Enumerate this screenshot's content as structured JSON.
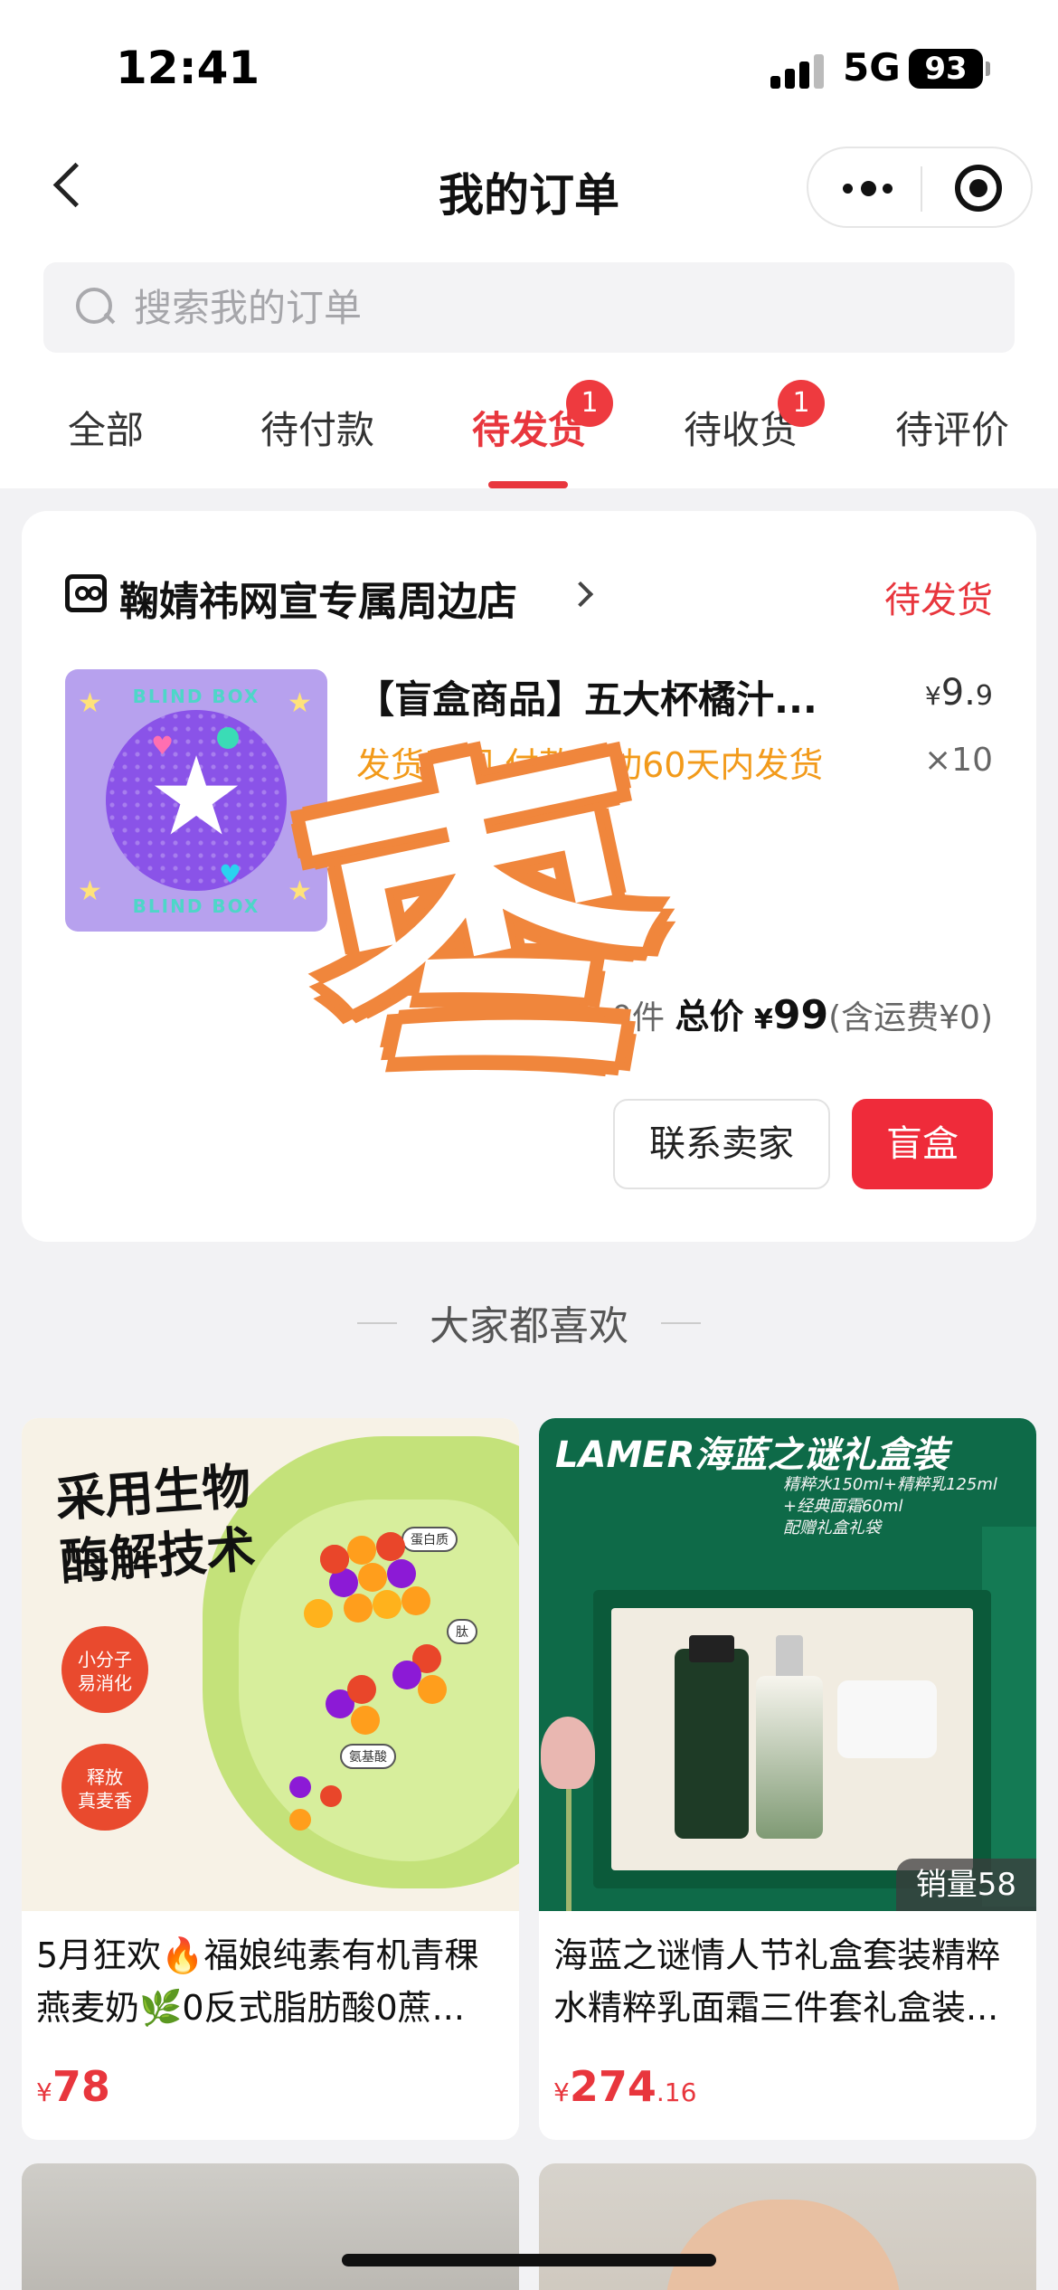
{
  "status_bar": {
    "time": "12:41",
    "network": "5G",
    "battery": "93"
  },
  "nav": {
    "title": "我的订单"
  },
  "search": {
    "placeholder": "搜索我的订单"
  },
  "tabs": [
    {
      "label": "全部",
      "badge": ""
    },
    {
      "label": "待付款",
      "badge": ""
    },
    {
      "label": "待发货",
      "badge": "1",
      "active": true
    },
    {
      "label": "待收货",
      "badge": "1"
    },
    {
      "label": "待评价",
      "badge": ""
    }
  ],
  "order": {
    "store_name": "鞠婧祎网宣专属周边店",
    "status": "待发货",
    "product": {
      "title": "【盲盒商品】五大杯橘汁...",
      "thumb_text_top": "BLIND BOX",
      "thumb_text_bottom": "BLIND BOX",
      "price_currency": "¥",
      "price_int": "9.",
      "price_dec": "9",
      "shipping_note": "发货时间 付款成功60天内发货",
      "quantity": "×10"
    },
    "total": {
      "count_text": "0件",
      "label": "总价",
      "currency": "¥",
      "amount": "99",
      "shipping": "(含运费¥0)"
    },
    "buttons": {
      "contact": "联系卖家",
      "primary": "盲盒"
    },
    "stamp": "枣"
  },
  "recommend": {
    "title": "大家都喜欢",
    "items": [
      {
        "name": "5月狂欢🔥福娘纯素有机青稞燕麦奶🌿0反式脂肪酸0蔗...",
        "price_currency": "¥",
        "price_int": "78",
        "price_dec": "",
        "sales": "",
        "image": {
          "headline": "采用生物\n酶解技术",
          "badge1": "小分子\n易消化",
          "badge2": "释放\n真麦香",
          "label_protein": "蛋白质",
          "label_peptide": "肽",
          "label_amino": "氨基酸"
        }
      },
      {
        "name": "海蓝之谜情人节礼盒套装精粹水精粹乳面霜三件套礼盒装...",
        "price_currency": "¥",
        "price_int": "274",
        "price_dec": ".16",
        "sales": "销量58",
        "image": {
          "headline": "LAMER海蓝之谜礼盒装",
          "sub": "精粹水150ml+精粹乳125ml\n+经典面霜60ml\n配赠礼盒礼袋"
        }
      }
    ]
  }
}
